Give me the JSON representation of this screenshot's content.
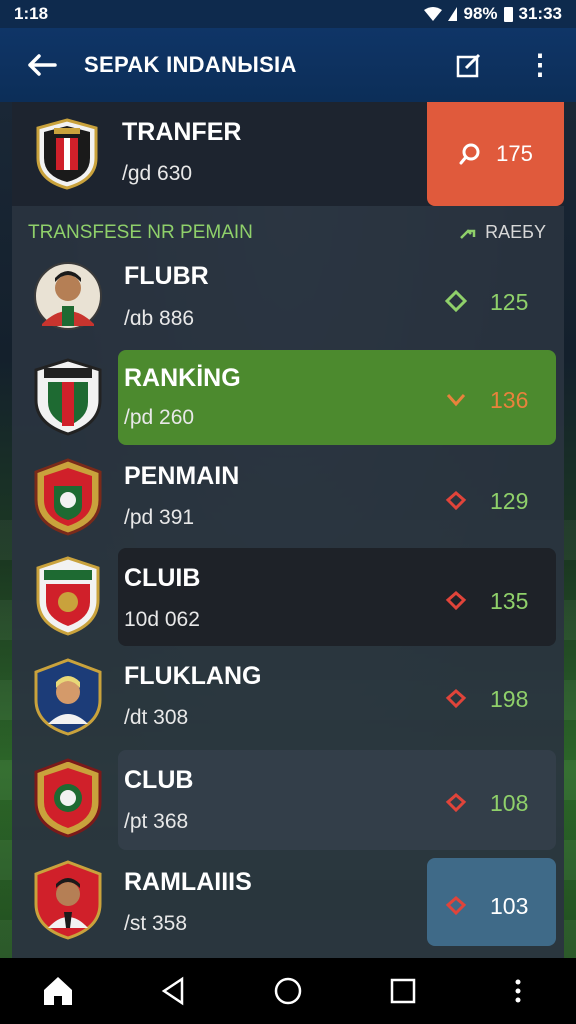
{
  "status": {
    "time": "1:18",
    "battery": "98%",
    "clock": "31:33"
  },
  "appbar": {
    "back_icon": "arrow-left-icon",
    "title": "SEPAK INDANЫSIA",
    "edit_icon": "edit-square-icon",
    "more_icon": "more-vert-icon"
  },
  "top_card": {
    "title": "TRANFER",
    "subtitle": "/gd 630",
    "badge_icon": "search-icon",
    "badge_value": "175",
    "badge_color": "#e05a3c"
  },
  "section": {
    "label": "TRANSFESE NR PEMAIN",
    "right_label": "RAEБY",
    "right_icon": "trend-icon"
  },
  "rows": [
    {
      "title": "FLUBR",
      "subtitle": "/ɑb 886",
      "icon": "diamond-icon",
      "value": "125",
      "value_color": "#8fd06a"
    },
    {
      "title": "RANKİNG",
      "subtitle": "/pd 260",
      "icon": "chevron-down-icon",
      "value": "136",
      "value_color": "#e8823c"
    },
    {
      "title": "PENMAIN",
      "subtitle": "/pd 391",
      "icon": "diamond-icon",
      "value": "129",
      "value_color": "#8fd06a"
    },
    {
      "title": "CLUIB",
      "subtitle": "10d 062",
      "icon": "diamond-icon",
      "value": "135",
      "value_color": "#8fd06a"
    },
    {
      "title": "FLUKLANG",
      "subtitle": "/dt 308",
      "icon": "diamond-icon",
      "value": "198",
      "value_color": "#8fd06a"
    },
    {
      "title": "CLUB",
      "subtitle": "/pt 368",
      "icon": "diamond-icon",
      "value": "108",
      "value_color": "#8fd06a"
    },
    {
      "title": "RAMLAIIIS",
      "subtitle": "/st 358",
      "icon": "diamond-icon",
      "value": "103",
      "value_color": "#ffffff"
    }
  ],
  "navbar": {
    "home_icon": "home-icon",
    "back_icon": "triangle-back-icon",
    "circle_icon": "circle-home-icon",
    "recents_icon": "square-recents-icon",
    "menu_icon": "dots-icon"
  }
}
